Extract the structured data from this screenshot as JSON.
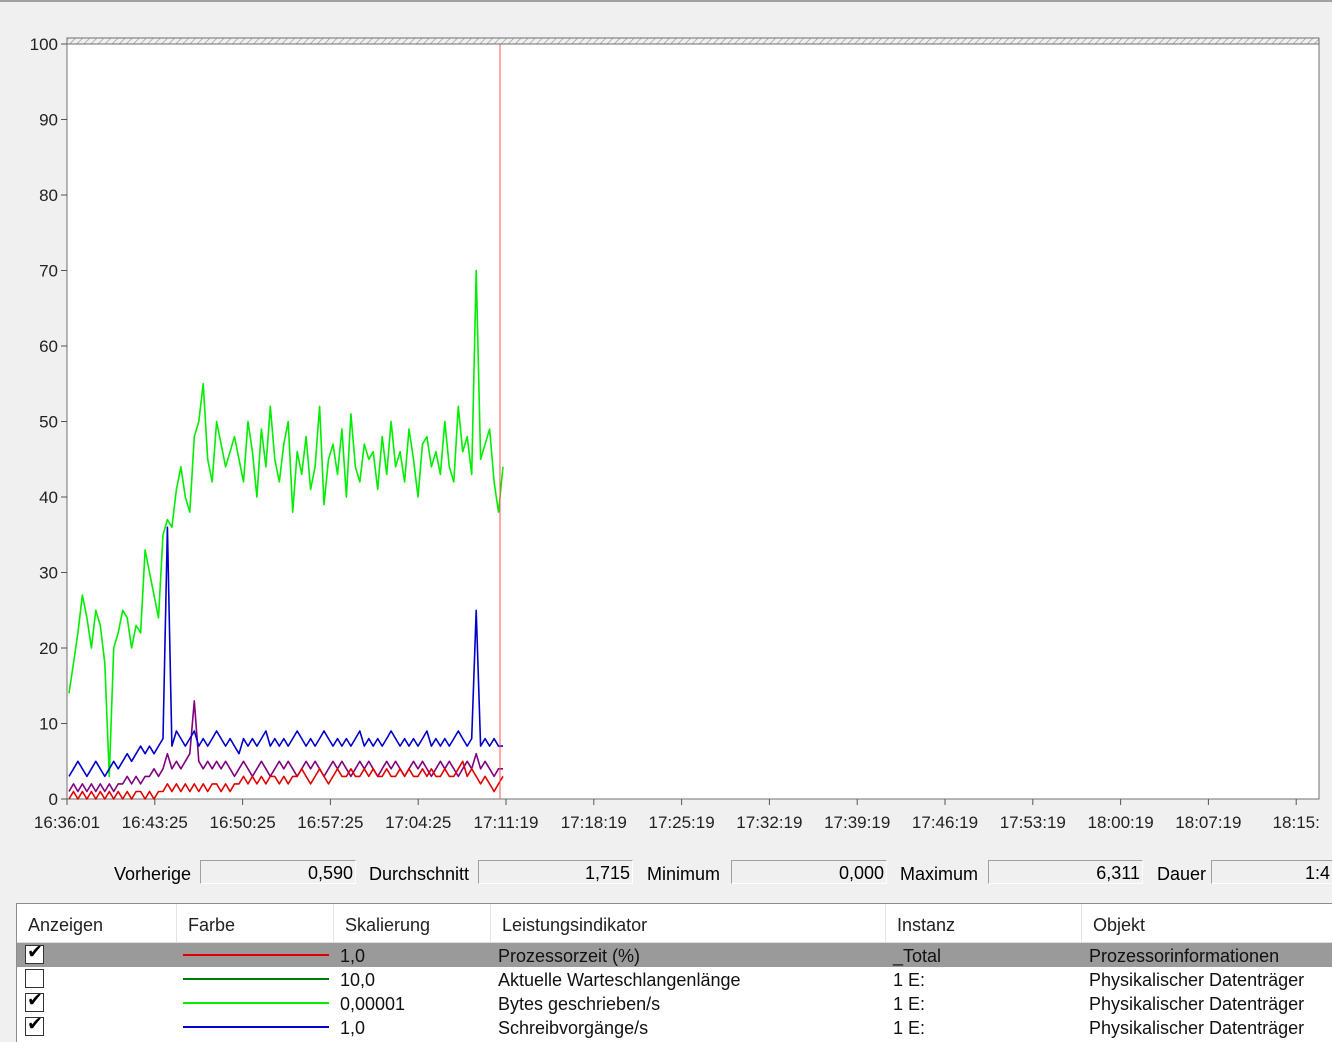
{
  "chart_data": {
    "type": "line",
    "y_ticks": [
      "0",
      "10",
      "20",
      "30",
      "40",
      "50",
      "60",
      "70",
      "80",
      "90",
      "100"
    ],
    "ylim": [
      0,
      100
    ],
    "x_tick_labels": [
      "16:36:01",
      "16:43:25",
      "16:50:25",
      "16:57:25",
      "17:04:25",
      "17:11:19",
      "17:18:19",
      "17:25:19",
      "17:32:19",
      "17:39:19",
      "17:46:19",
      "17:53:19",
      "18:00:19",
      "18:07:19",
      "18:15:"
    ],
    "time_cursor": "17:11:19",
    "grid": false,
    "series": [
      {
        "color": "#00ee00",
        "values": [
          14,
          18,
          22,
          27,
          24,
          20,
          25,
          23,
          18,
          3,
          20,
          22,
          25,
          24,
          20,
          23,
          22,
          33,
          30,
          27,
          24,
          35,
          37,
          36,
          41,
          44,
          40,
          38,
          48,
          50,
          55,
          45,
          42,
          50,
          47,
          44,
          46,
          48,
          45,
          42,
          50,
          46,
          40,
          49,
          44,
          52,
          45,
          42,
          47,
          50,
          38,
          46,
          43,
          48,
          41,
          44,
          52,
          39,
          45,
          47,
          43,
          49,
          40,
          51,
          44,
          42,
          47,
          45,
          46,
          41,
          48,
          43,
          50,
          44,
          46,
          42,
          49,
          45,
          40,
          47,
          48,
          44,
          46,
          43,
          50,
          44,
          42,
          52,
          46,
          48,
          43,
          70,
          45,
          47,
          49,
          42,
          38,
          44
        ]
      },
      {
        "color": "#0000cc",
        "values": [
          3,
          4,
          5,
          4,
          3,
          4,
          5,
          4,
          3,
          4,
          5,
          4,
          5,
          6,
          5,
          6,
          7,
          6,
          7,
          6,
          7,
          8,
          36,
          7,
          9,
          8,
          7,
          8,
          9,
          7,
          8,
          7,
          8,
          9,
          8,
          7,
          8,
          7,
          6,
          8,
          7,
          8,
          7,
          8,
          9,
          7,
          8,
          7,
          8,
          7,
          8,
          9,
          8,
          7,
          8,
          7,
          8,
          9,
          8,
          7,
          8,
          7,
          8,
          7,
          8,
          9,
          7,
          8,
          7,
          8,
          7,
          8,
          9,
          8,
          7,
          8,
          7,
          8,
          7,
          8,
          9,
          7,
          8,
          7,
          8,
          7,
          8,
          9,
          8,
          7,
          8,
          25,
          7,
          8,
          7,
          8,
          7,
          7
        ]
      },
      {
        "color": "#800080",
        "values": [
          1,
          2,
          1,
          2,
          1,
          2,
          1,
          2,
          1,
          2,
          1,
          2,
          2,
          3,
          2,
          3,
          2,
          3,
          3,
          4,
          3,
          4,
          6,
          4,
          5,
          4,
          5,
          6,
          13,
          5,
          4,
          5,
          4,
          5,
          4,
          5,
          4,
          3,
          4,
          5,
          4,
          3,
          4,
          5,
          4,
          3,
          4,
          5,
          4,
          5,
          4,
          3,
          4,
          5,
          4,
          5,
          4,
          3,
          4,
          5,
          4,
          5,
          4,
          3,
          4,
          5,
          4,
          5,
          4,
          3,
          4,
          5,
          4,
          5,
          4,
          3,
          4,
          5,
          4,
          5,
          4,
          3,
          4,
          5,
          4,
          5,
          4,
          3,
          4,
          5,
          4,
          6,
          4,
          5,
          4,
          3,
          4,
          4
        ]
      },
      {
        "color": "#e00000",
        "values": [
          0,
          1,
          0,
          1,
          0,
          1,
          0,
          1,
          0,
          1,
          0,
          1,
          0,
          1,
          0,
          1,
          1,
          0,
          1,
          0,
          1,
          1,
          2,
          1,
          2,
          1,
          2,
          1,
          2,
          1,
          2,
          1,
          2,
          2,
          1,
          2,
          1,
          2,
          2,
          3,
          2,
          3,
          2,
          3,
          2,
          3,
          3,
          2,
          3,
          2,
          3,
          3,
          4,
          3,
          2,
          3,
          4,
          3,
          2,
          3,
          4,
          3,
          3,
          4,
          3,
          3,
          4,
          3,
          4,
          3,
          3,
          4,
          3,
          3,
          4,
          3,
          4,
          3,
          3,
          4,
          3,
          4,
          3,
          3,
          4,
          3,
          3,
          4,
          5,
          3,
          4,
          3,
          2,
          3,
          2,
          1,
          2,
          3
        ]
      }
    ]
  },
  "stats": {
    "prev_label": "Vorherige",
    "prev_value": "0,590",
    "avg_label": "Durchschnitt",
    "avg_value": "1,715",
    "min_label": "Minimum",
    "min_value": "0,000",
    "max_label": "Maximum",
    "max_value": "6,311",
    "dur_label": "Dauer",
    "dur_value": "1:4"
  },
  "legend": {
    "headers": {
      "show": "Anzeigen",
      "color": "Farbe",
      "scale": "Skalierung",
      "counter": "Leistungsindikator",
      "instance": "Instanz",
      "object": "Objekt"
    },
    "rows": [
      {
        "checked": true,
        "color": "#e00000",
        "scale": "1,0",
        "counter": "Prozessorzeit (%)",
        "instance": "_Total",
        "object": "Prozessorinformationen"
      },
      {
        "checked": false,
        "color": "#008000",
        "scale": "10,0",
        "counter": "Aktuelle Warteschlangenlänge",
        "instance": "1 E:",
        "object": "Physikalischer Datenträger"
      },
      {
        "checked": true,
        "color": "#00ee00",
        "scale": "0,00001",
        "counter": "Bytes geschrieben/s",
        "instance": "1 E:",
        "object": "Physikalischer Datenträger"
      },
      {
        "checked": true,
        "color": "#0000cc",
        "scale": "1,0",
        "counter": "Schreibvorgänge/s",
        "instance": "1 E:",
        "object": "Physikalischer Datenträger"
      }
    ]
  }
}
